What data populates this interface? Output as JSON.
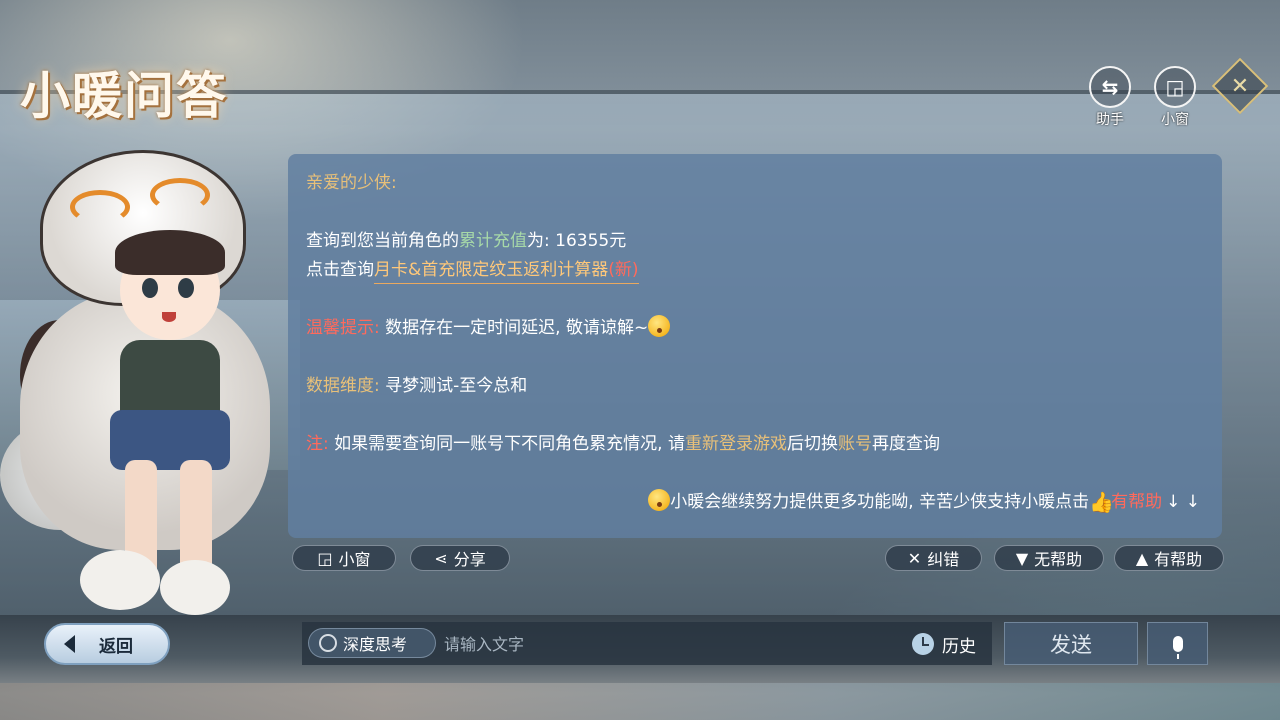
{
  "title": "小暖问答",
  "top_buttons": {
    "assistant_label": "助手",
    "window_label": "小窗"
  },
  "chat": {
    "greeting": "亲爱的少侠:",
    "query_prefix": "查询到您当前角色的",
    "query_highlight": "累计充值",
    "query_suffix": "为: 16355元",
    "click_prefix": "点击查询",
    "calculator_link": "月卡&首充限定纹玉返利计算器",
    "new_tag": "(新)",
    "tip_label": "温馨提示:",
    "tip_text": " 数据存在一定时间延迟, 敬请谅解~",
    "dimension_label": "数据维度:",
    "dimension_text": " 寻梦测试-至今总和",
    "note_label": "注:",
    "note_text_1": " 如果需要查询同一账号下不同角色累充情况, 请",
    "note_highlight_1": "重新登录游戏",
    "note_text_2": "后切换",
    "note_highlight_2": "账号",
    "note_text_3": "再度查询",
    "footer_text": "小暖会继续努力提供更多功能呦, 辛苦少侠支持小暖点击",
    "footer_helpful": "有帮助",
    "footer_arrows": "↓ ↓"
  },
  "actions": {
    "mini_window": "小窗",
    "share": "分享",
    "correct": "纠错",
    "not_helpful": "无帮助",
    "helpful": "有帮助"
  },
  "bottom": {
    "back": "返回",
    "deep_think": "深度思考",
    "input_placeholder": "请输入文字",
    "history": "历史",
    "send": "发送"
  },
  "colors": {
    "gold": "#e8c079",
    "green": "#a7d9a8",
    "red": "#ff6a5c",
    "panel": "#607ea0"
  },
  "icons": [
    "swap-icon",
    "mini-window-icon",
    "close-icon",
    "share-icon",
    "x-icon",
    "thumbs-down-icon",
    "thumbs-up-icon",
    "back-arrow-icon",
    "clock-icon",
    "mic-icon"
  ]
}
